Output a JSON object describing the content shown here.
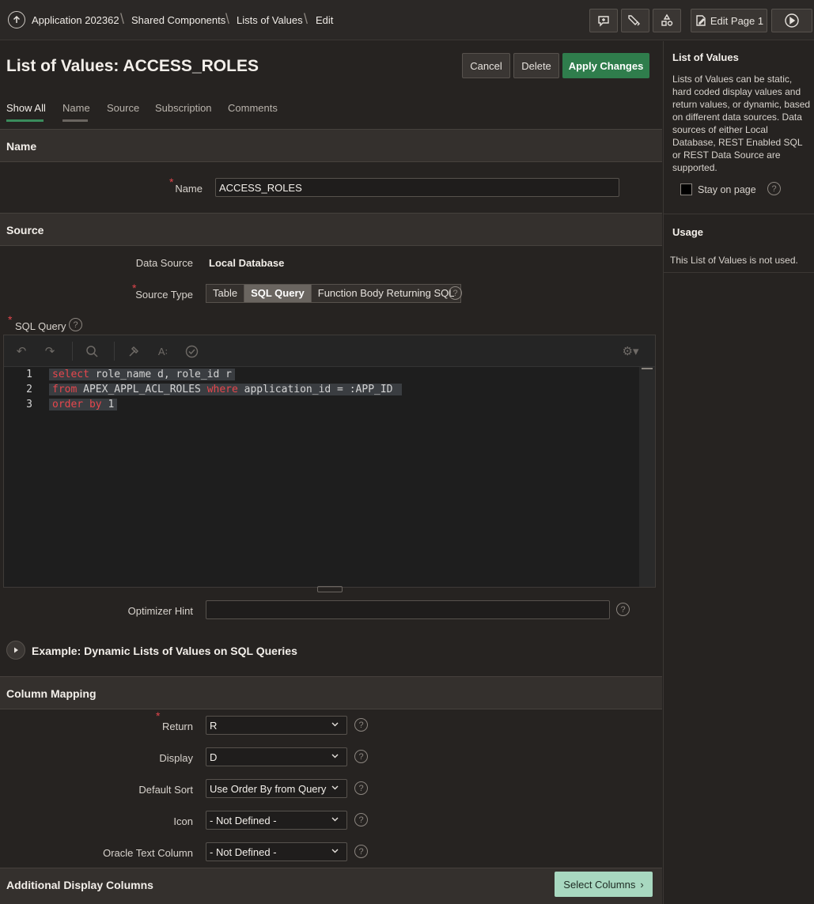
{
  "breadcrumb": {
    "items": [
      "Application 202362",
      "Shared Components",
      "Lists of Values",
      "Edit"
    ]
  },
  "toolbar": {
    "edit_page_label": "Edit Page 1"
  },
  "page": {
    "title": "List of Values: ACCESS_ROLES",
    "cancel_label": "Cancel",
    "delete_label": "Delete",
    "apply_label": "Apply Changes"
  },
  "tabs": [
    "Show All",
    "Name",
    "Source",
    "Subscription",
    "Comments"
  ],
  "name_section": {
    "heading": "Name",
    "name_label": "Name",
    "name_value": "ACCESS_ROLES"
  },
  "source_section": {
    "heading": "Source",
    "data_source_label": "Data Source",
    "data_source_value": "Local Database",
    "source_type_label": "Source Type",
    "source_type_options": [
      "Table",
      "SQL Query",
      "Function Body Returning SQL"
    ],
    "source_type_selected": "SQL Query",
    "sql_query_label": "SQL Query",
    "code_lines": [
      {
        "num": "1",
        "parts": [
          {
            "t": "select",
            "kw": true
          },
          {
            "t": " role_name d, role_id r",
            "kw": false
          }
        ]
      },
      {
        "num": "2",
        "parts": [
          {
            "t": "from",
            "kw": true
          },
          {
            "t": " APEX_APPL_ACL_ROLES ",
            "kw": false
          },
          {
            "t": "where",
            "kw": true
          },
          {
            "t": " application_id = :APP_ID ",
            "kw": false
          }
        ]
      },
      {
        "num": "3",
        "parts": [
          {
            "t": "order by",
            "kw": true
          },
          {
            "t": " 1",
            "kw": false
          }
        ]
      }
    ],
    "optimizer_hint_label": "Optimizer Hint",
    "optimizer_hint_value": "",
    "example_label": "Example: Dynamic Lists of Values on SQL Queries"
  },
  "column_mapping": {
    "heading": "Column Mapping",
    "fields": [
      {
        "label": "Return",
        "value": "R",
        "required": true
      },
      {
        "label": "Display",
        "value": "D",
        "required": false
      },
      {
        "label": "Default Sort",
        "value": "Use Order By from Query",
        "required": false
      },
      {
        "label": "Icon",
        "value": "- Not Defined -",
        "required": false
      },
      {
        "label": "Oracle Text Column",
        "value": "- Not Defined -",
        "required": false
      }
    ]
  },
  "additional": {
    "heading": "Additional Display Columns",
    "select_columns_label": "Select Columns"
  },
  "side": {
    "lov_heading": "List of Values",
    "lov_text": "Lists of Values can be static, hard coded display values and return values, or dynamic, based on different data sources. Data sources of either Local Database, REST Enabled SQL or REST Data Source are supported.",
    "stay_label": "Stay on page",
    "usage_heading": "Usage",
    "usage_text": "This List of Values is not used."
  },
  "colors": {
    "accent_green": "#2f7d4c",
    "keyword_red": "#e6474d",
    "required_red": "#e0454b",
    "select_columns_bg": "#a8d8c0"
  }
}
